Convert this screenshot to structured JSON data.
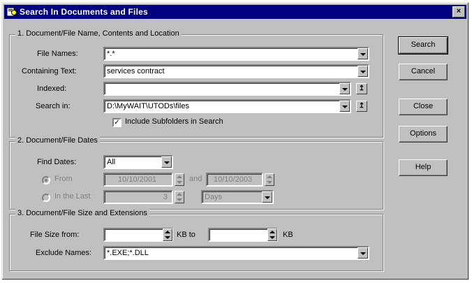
{
  "window": {
    "title": "Search In Documents and Files",
    "close_symbol": "×"
  },
  "section1": {
    "legend": "1. Document/File Name, Contents and Location",
    "file_names": {
      "label": "File Names:",
      "value": "*.*"
    },
    "containing_text": {
      "label": "Containing Text:",
      "value": "services contract"
    },
    "indexed": {
      "label": "Indexed:",
      "value": ""
    },
    "search_in": {
      "label": "Search in:",
      "value": "D:\\MyWAIT\\UTODs\\files"
    },
    "include_subfolders": {
      "label": "Include Subfolders in Search",
      "checked": true,
      "check_symbol": "✓"
    }
  },
  "section2": {
    "legend": "2. Document/File Dates",
    "find_dates": {
      "label": "Find Dates:",
      "value": "All"
    },
    "from": {
      "label": "From",
      "start": "10/10/2001",
      "and": "and",
      "end": "10/10/2003"
    },
    "in_the_last": {
      "label": "In the Last",
      "count": "3",
      "unit": "Days"
    }
  },
  "section3": {
    "legend": "3. Document/File Size and Extensions",
    "file_size": {
      "label": "File Size from:",
      "from": "",
      "to_label": "KB to",
      "to": "",
      "unit": "KB"
    },
    "exclude_names": {
      "label": "Exclude Names:",
      "value": "*.EXE;*.DLL"
    }
  },
  "buttons": {
    "search": "Search",
    "cancel": "Cancel",
    "close": "Close",
    "options": "Options",
    "help": "Help"
  },
  "icons": {
    "browse_indexed": "↥",
    "browse_folder": "↥"
  }
}
